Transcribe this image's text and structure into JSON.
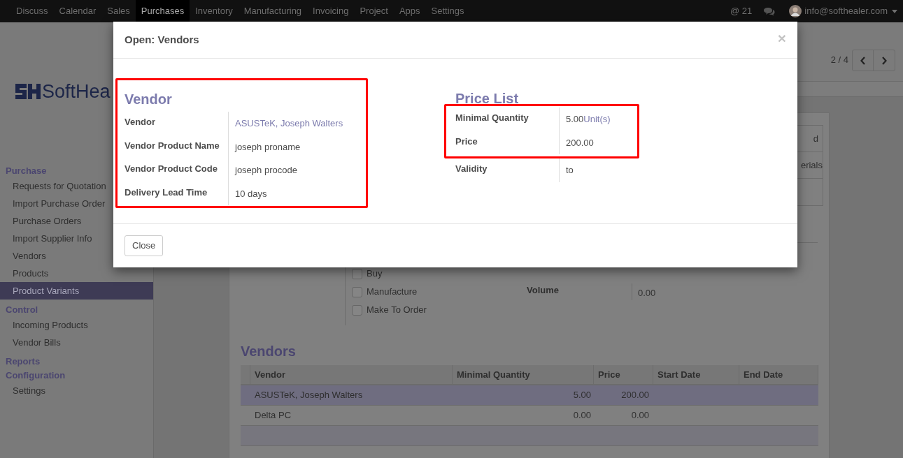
{
  "navbar": {
    "menu": [
      {
        "label": "Discuss",
        "selected": false
      },
      {
        "label": "Calendar",
        "selected": false
      },
      {
        "label": "Sales",
        "selected": false
      },
      {
        "label": "Purchases",
        "selected": true
      },
      {
        "label": "Inventory",
        "selected": false
      },
      {
        "label": "Manufacturing",
        "selected": false
      },
      {
        "label": "Invoicing",
        "selected": false
      },
      {
        "label": "Project",
        "selected": false
      },
      {
        "label": "Apps",
        "selected": false
      },
      {
        "label": "Settings",
        "selected": false
      }
    ],
    "mentions": "@ 21",
    "user": "info@softhealer.com"
  },
  "sidebar": {
    "logo": "SoftHea",
    "sections": [
      {
        "title": "Purchase",
        "items": [
          {
            "label": "Requests for Quotation",
            "selected": false
          },
          {
            "label": "Import Purchase Order",
            "selected": false
          },
          {
            "label": "Purchase Orders",
            "selected": false
          },
          {
            "label": "Import Supplier Info",
            "selected": false
          },
          {
            "label": "Vendors",
            "selected": false
          },
          {
            "label": "Products",
            "selected": false
          },
          {
            "label": "Product Variants",
            "selected": true
          }
        ]
      },
      {
        "title": "Control",
        "items": [
          {
            "label": "Incoming Products",
            "selected": false
          },
          {
            "label": "Vendor Bills",
            "selected": false
          }
        ]
      },
      {
        "title": "Reports"
      },
      {
        "title": "Configuration",
        "items": [
          {
            "label": "Settings",
            "selected": false
          }
        ]
      }
    ]
  },
  "pager": "2 / 4",
  "form": {
    "partial_cells": [
      "d",
      "erials"
    ],
    "checkboxes": [
      {
        "label": "Buy",
        "checked": false
      },
      {
        "label": "Manufacture",
        "checked": false
      },
      {
        "label": "Make To Order",
        "checked": false
      }
    ],
    "fields": [
      {
        "label": "Volume",
        "value": "0.00"
      }
    ],
    "vendors": {
      "title": "Vendors",
      "columns": [
        "Vendor",
        "Minimal Quantity",
        "Price",
        "Start Date",
        "End Date"
      ],
      "rows": [
        {
          "cells": [
            "ASUSTeK, Joseph Walters",
            "5.00",
            "200.00",
            "",
            ""
          ],
          "selected": true
        },
        {
          "cells": [
            "Delta PC",
            "0.00",
            "0.00",
            "",
            ""
          ],
          "selected": false
        }
      ]
    }
  },
  "dialog": {
    "title": "Open: Vendors",
    "close": "×",
    "vendor_group": {
      "title": "Vendor",
      "fields": [
        {
          "label": "Vendor",
          "value": "ASUSTeK, Joseph Walters",
          "kind": "link"
        },
        {
          "label": "Vendor Product Name",
          "value": "joseph proname",
          "kind": "text"
        },
        {
          "label": "Vendor Product Code",
          "value": "joseph procode",
          "kind": "text"
        },
        {
          "label": "Delivery Lead Time",
          "value": "10 days",
          "kind": "text"
        }
      ]
    },
    "price_list": {
      "title": "Price List",
      "fields": [
        {
          "label": "Minimal Quantity",
          "value": "5.00",
          "unit": "Unit(s)",
          "highlighted": true
        },
        {
          "label": "Price",
          "value": "200.00",
          "highlighted": true
        },
        {
          "label": "Validity",
          "value": "to",
          "highlighted": false
        }
      ]
    },
    "buttons": [
      "Close"
    ]
  }
}
